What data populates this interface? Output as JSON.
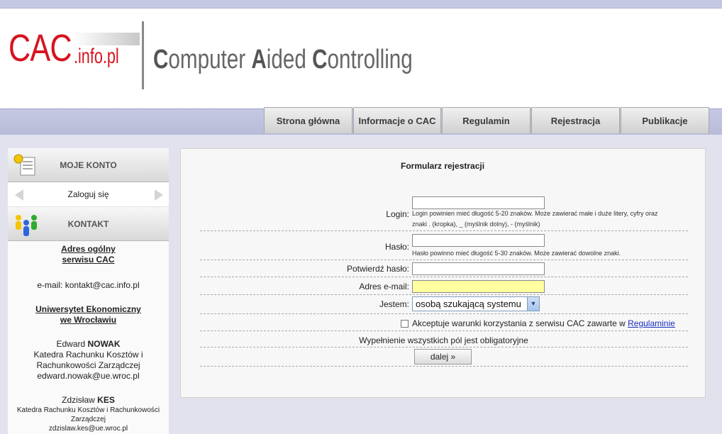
{
  "logo": {
    "main": "CAC",
    "suffix": ".info.pl"
  },
  "tagline": {
    "c1": "C",
    "r1": "omputer ",
    "c2": "A",
    "r2": "ided ",
    "c3": "C",
    "r3": "ontrolling"
  },
  "nav": [
    "Strona główna",
    "Informacje o CAC",
    "Regulamin",
    "Rejestracja",
    "Publikacje"
  ],
  "sidebar": {
    "account_title": "MOJE KONTO",
    "login_label": "Zaloguj się",
    "contact_title": "KONTAKT",
    "contact": {
      "general_h1": "Adres ogólny",
      "general_h2": "serwisu CAC",
      "general_email": "e-mail: kontakt@cac.info.pl",
      "univ_h1": "Uniwersytet Ekonomiczny",
      "univ_h2": "we Wrocławiu",
      "p1_first": "Edward ",
      "p1_last": "NOWAK",
      "p1_dept1": "Katedra Rachunku Kosztów i",
      "p1_dept2": "Rachunkowości Zarządczej",
      "p1_email": "edward.nowak@ue.wroc.pl",
      "p2_first": "Zdzisław ",
      "p2_last": "KES",
      "p2_dept1": "Katedra Rachunku Kosztów i Rachunkowości",
      "p2_dept2": "Zarządczej",
      "p2_email": "zdzislaw.kes@ue.wroc.pl"
    }
  },
  "form": {
    "title": "Formularz rejestracji",
    "login_label": "Login:",
    "login_hint1": "Login powinien mieć długość 5-20 znaków. Może zawierać małe i duże litery, cyfry oraz",
    "login_hint2": "znaki . (kropka), _ (myślnik dolny), - (myślnik)",
    "password_label": "Hasło:",
    "password_hint": "Hasło powinno mieć długość 5-30 znaków. Może zawierać dowolne znaki.",
    "confirm_label": "Potwierdź hasło:",
    "email_label": "Adres e-mail:",
    "role_label": "Jestem:",
    "role_value": "osobą szukającą systemu",
    "terms_text": "Akceptuje warunki korzystania z serwisu CAC zawarte w ",
    "terms_link": "Regulaminie",
    "required_note": "Wypełnienie wszystkich pól jest obligatoryjne",
    "next_button": "dalej »"
  },
  "colors": {
    "brand": "#d8121e",
    "link": "#1a2fbf",
    "email_highlight": "#ffffa0"
  }
}
